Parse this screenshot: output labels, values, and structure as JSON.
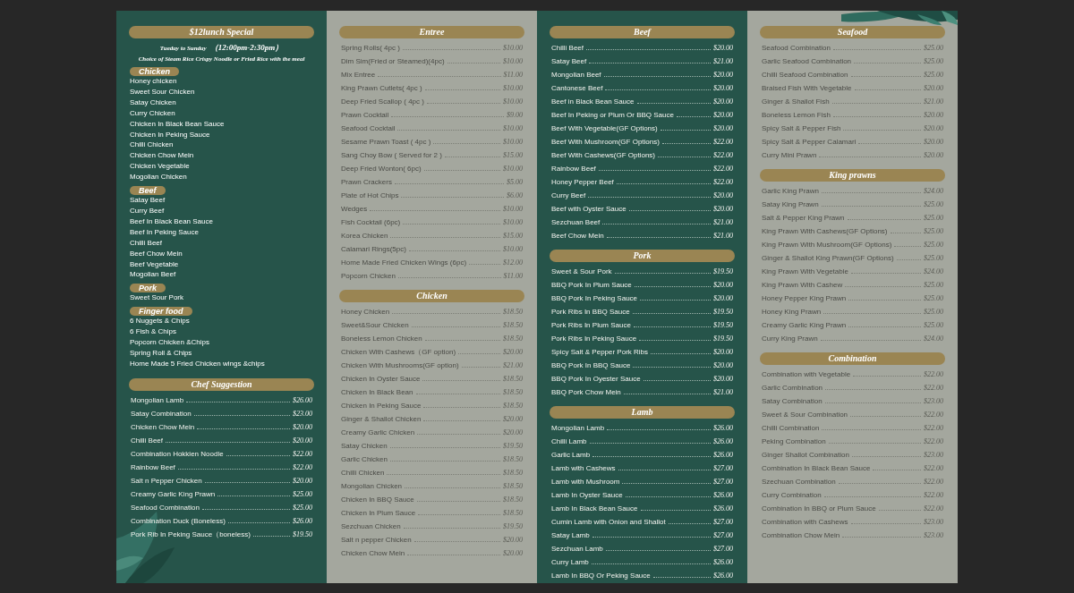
{
  "columns": [
    {
      "kind": "green",
      "sections": [
        {
          "kind": "lunch",
          "title": "$12lunch Special",
          "days": "Tueday to Sunday",
          "hours": "（12:00pm-2:30pm）",
          "note": "Choice of Steam Rice Crispy Noodle or Fried Rice with the meal",
          "groups": [
            {
              "title": "Chicken",
              "items": [
                "Honey chicken",
                "Sweet Sour Chicken",
                "Satay Chicken",
                "Curry Chicken",
                "Chicken In Black Bean Sauce",
                "Chicken In Peking Sauce",
                "Chilli Chicken",
                "Chicken Chow Mein",
                "Chicken Vegetable",
                "Mogolian Chicken"
              ]
            },
            {
              "title": "Beef",
              "items": [
                "Satay Beef",
                "Curry Beef",
                "Beef In Black Bean Sauce",
                "Beef In Peking Sauce",
                "Chilli Beef",
                "Beef Chow Mein",
                "Beef Vegetable",
                "Mogolian Beef"
              ]
            },
            {
              "title": "Pork",
              "items": [
                "Sweet Sour Pork"
              ]
            },
            {
              "title": "Finger food",
              "items": [
                "6 Nuggets & Chips",
                "6 Fish & Chips",
                "Popcorn Chicken &Chips",
                "Spring Roll & Chips",
                "Home Made 5 Fried Chicken wings &chips"
              ]
            }
          ]
        },
        {
          "kind": "priced",
          "title": "Chef Suggestion",
          "items": [
            {
              "name": "Mongolian Lamb",
              "price": "$26.00"
            },
            {
              "name": "Satay Combination",
              "price": "$23.00"
            },
            {
              "name": "Chicken Chow Mein",
              "price": "$20.00"
            },
            {
              "name": "Chilli Beef",
              "price": "$20.00"
            },
            {
              "name": "Combination Hokkien Noodle",
              "price": "$22.00"
            },
            {
              "name": "Rainbow Beef",
              "price": "$22.00"
            },
            {
              "name": "Salt n Pepper Chicken",
              "price": "$20.00"
            },
            {
              "name": "Creamy Garlic King Prawn",
              "price": "$25.00"
            },
            {
              "name": "Seafood Combination",
              "price": "$25.00"
            },
            {
              "name": "Combination Duck (Boneless)",
              "price": "$26.00"
            },
            {
              "name": "Pork Rib In Peking Sauce（boneless)",
              "price": "$19.50"
            }
          ]
        }
      ]
    },
    {
      "kind": "grey",
      "sections": [
        {
          "kind": "priced",
          "title": "Entree",
          "items": [
            {
              "name": "Spring Rolls( 4pc )",
              "price": "$10.00"
            },
            {
              "name": "Dim Sim(Fried or Steamed)(4pc)",
              "price": "$10.00"
            },
            {
              "name": "Mix Entree",
              "price": "$11.00"
            },
            {
              "name": "King Prawn Cutlets( 4pc )",
              "price": "$10.00"
            },
            {
              "name": "Deep Fried Scallop ( 4pc )",
              "price": "$10.00"
            },
            {
              "name": "Prawn Cocktail",
              "price": "$9.00"
            },
            {
              "name": "Seafood Cocktail",
              "price": "$10.00"
            },
            {
              "name": "Sesame Prawn Toast ( 4pc )",
              "price": "$10.00"
            },
            {
              "name": "Sang Choy Bow ( Served for 2 )",
              "price": "$15.00"
            },
            {
              "name": "Deep Fried Wonton( 6pc)",
              "price": "$10.00"
            },
            {
              "name": "Prawn Crackers",
              "price": "$5.00"
            },
            {
              "name": "Plate of Hot Chips",
              "price": "$6.00"
            },
            {
              "name": "Wedges",
              "price": "$10.00"
            },
            {
              "name": "Fish Cocktail (6pc)",
              "price": "$10.00"
            },
            {
              "name": "Korea Chicken",
              "price": "$15.00"
            },
            {
              "name": "Calamari Rings(5pc)",
              "price": "$10.00"
            },
            {
              "name": "Home Made Fried Chicken Wings (6pc)",
              "price": "$12.00"
            },
            {
              "name": "Popcorn Chicken",
              "price": "$11.00"
            }
          ]
        },
        {
          "kind": "priced",
          "title": "Chicken",
          "items": [
            {
              "name": "Honey Chicken",
              "price": "$18.50"
            },
            {
              "name": "Sweet&Sour Chicken",
              "price": "$18.50"
            },
            {
              "name": "Boneless Lemon Chicken",
              "price": "$18.50"
            },
            {
              "name": "Chicken With Cashews（GF option)",
              "price": "$20.00"
            },
            {
              "name": "Chicken With Mushrooms(GF option)",
              "price": "$21.00"
            },
            {
              "name": "Chicken In Oyster Sauce",
              "price": "$18.50"
            },
            {
              "name": "Chicken In Black Bean",
              "price": "$18.50"
            },
            {
              "name": "Chicken In Peking Sauce",
              "price": "$18.50"
            },
            {
              "name": "Ginger & Shallot Chicken",
              "price": "$20.00"
            },
            {
              "name": "Creamy Garlic Chicken",
              "price": "$20.00"
            },
            {
              "name": "Satay Chicken",
              "price": "$19.50"
            },
            {
              "name": "Garlic Chicken",
              "price": "$18.50"
            },
            {
              "name": "Chilli Chicken",
              "price": "$18.50"
            },
            {
              "name": "Mongolian Chicken",
              "price": "$18.50"
            },
            {
              "name": "Chicken In BBQ Sauce",
              "price": "$18.50"
            },
            {
              "name": "Chicken In Plum Sauce",
              "price": "$18.50"
            },
            {
              "name": "Sezchuan Chicken",
              "price": "$19.50"
            },
            {
              "name": "Salt n pepper Chicken",
              "price": "$20.00"
            },
            {
              "name": "Chicken Chow Mein",
              "price": "$20.00"
            }
          ]
        }
      ]
    },
    {
      "kind": "green",
      "sections": [
        {
          "kind": "priced",
          "title": "Beef",
          "items": [
            {
              "name": "Chilli Beef",
              "price": "$20.00"
            },
            {
              "name": "Satay Beef",
              "price": "$21.00"
            },
            {
              "name": "Mongolian Beef",
              "price": "$20.00"
            },
            {
              "name": "Cantonese Beef",
              "price": "$20.00"
            },
            {
              "name": "Beef in Black Bean Sauce",
              "price": "$20.00"
            },
            {
              "name": "Beef In Peking or Plum Or BBQ Sauce",
              "price": "$20.00"
            },
            {
              "name": "Beef With Vegetable(GF Options)",
              "price": "$20.00"
            },
            {
              "name": "Beef With Mushroom(GF Options)",
              "price": "$22.00"
            },
            {
              "name": "Beef With Cashews(GF Options)",
              "price": "$22.00"
            },
            {
              "name": "Rainbow Beef",
              "price": "$22.00"
            },
            {
              "name": "Honey Pepper Beef",
              "price": "$22.00"
            },
            {
              "name": "Curry Beef",
              "price": "$20.00"
            },
            {
              "name": "Beef with Oyster Sauce",
              "price": "$20.00"
            },
            {
              "name": "Sezchuan Beef",
              "price": "$21.00"
            },
            {
              "name": "Beef Chow Mein",
              "price": "$21.00"
            }
          ]
        },
        {
          "kind": "priced",
          "title": "Pork",
          "items": [
            {
              "name": "Sweet & Sour Pork",
              "price": "$19.50"
            },
            {
              "name": "BBQ Pork In Plum Sauce",
              "price": "$20.00"
            },
            {
              "name": "BBQ Pork In Peking Sauce",
              "price": "$20.00"
            },
            {
              "name": "Pork Ribs In BBQ Sauce",
              "price": "$19.50"
            },
            {
              "name": "Pork Ribs In Plum Sauce",
              "price": "$19.50"
            },
            {
              "name": "Pork Ribs In Peking Sauce",
              "price": "$19.50"
            },
            {
              "name": "Spicy Salt & Pepper Pork Ribs",
              "price": "$20.00"
            },
            {
              "name": "BBQ Pork In BBQ Sauce",
              "price": "$20.00"
            },
            {
              "name": "BBQ Pork In Oyester Sauce",
              "price": "$20.00"
            },
            {
              "name": "BBQ Pork Chow Mein",
              "price": "$21.00"
            }
          ]
        },
        {
          "kind": "priced",
          "title": "Lamb",
          "items": [
            {
              "name": "Mongolian Lamb",
              "price": "$26.00"
            },
            {
              "name": "Chilli Lamb",
              "price": "$26.00"
            },
            {
              "name": "Garlic Lamb",
              "price": "$26.00"
            },
            {
              "name": "Lamb with Cashews",
              "price": "$27.00"
            },
            {
              "name": "Lamb with Mushroom",
              "price": "$27.00"
            },
            {
              "name": "Lamb In Oyster Sauce",
              "price": "$26.00"
            },
            {
              "name": "Lamb In Black Bean Sauce",
              "price": "$26.00"
            },
            {
              "name": "Cumin Lamb with Onion and Shallot",
              "price": "$27.00"
            },
            {
              "name": "Satay Lamb",
              "price": "$27.00"
            },
            {
              "name": "Sezchuan Lamb",
              "price": "$27.00"
            },
            {
              "name": "Curry Lamb",
              "price": "$26.00"
            },
            {
              "name": "Lamb In BBQ Or Peking Sauce",
              "price": "$26.00"
            }
          ]
        }
      ]
    },
    {
      "kind": "grey",
      "sections": [
        {
          "kind": "priced",
          "title": "Seafood",
          "items": [
            {
              "name": "Seafood Combination",
              "price": "$25.00"
            },
            {
              "name": "Garlic Seafood Combination",
              "price": "$25.00"
            },
            {
              "name": "Chilli Seafood Combination",
              "price": "$25.00"
            },
            {
              "name": "Braised Fish With Vegetable",
              "price": "$20.00"
            },
            {
              "name": "Ginger & Shallot Fish",
              "price": "$21.00"
            },
            {
              "name": "Boneless Lemon Fish",
              "price": "$20.00"
            },
            {
              "name": "Spicy Salt & Pepper Fish",
              "price": "$20.00"
            },
            {
              "name": "Spicy Salt & Pepper Calamari",
              "price": "$20.00"
            },
            {
              "name": "Curry Mini Prawn",
              "price": "$20.00"
            }
          ]
        },
        {
          "kind": "priced",
          "title": "King prawns",
          "items": [
            {
              "name": "Garlic King Prawn",
              "price": "$24.00"
            },
            {
              "name": "Satay King Prawn",
              "price": "$25.00"
            },
            {
              "name": "Salt & Pepper King Prawn",
              "price": "$25.00"
            },
            {
              "name": "King Prawn With Cashews(GF Options)",
              "price": "$25.00"
            },
            {
              "name": "King Prawn With Mushroom(GF Options)",
              "price": "$25.00"
            },
            {
              "name": "Ginger & Shallot King Prawn(GF Options)",
              "price": "$25.00"
            },
            {
              "name": "King Prawn With Vegetable",
              "price": "$24.00"
            },
            {
              "name": "King Prawn With Cashew",
              "price": "$25.00"
            },
            {
              "name": "Honey Pepper King Prawn",
              "price": "$25.00"
            },
            {
              "name": "Honey King Prawn",
              "price": "$25.00"
            },
            {
              "name": "Creamy Garlic King Prawn",
              "price": "$25.00"
            },
            {
              "name": "Curry King Prawn",
              "price": "$24.00"
            }
          ]
        },
        {
          "kind": "priced",
          "title": "Combination",
          "items": [
            {
              "name": "Combination with Vegetable",
              "price": "$22.00"
            },
            {
              "name": "Garlic Combination",
              "price": "$22.00"
            },
            {
              "name": "Satay Combination",
              "price": "$23.00"
            },
            {
              "name": "Sweet & Sour Combination",
              "price": "$22.00"
            },
            {
              "name": "Chilli Combination",
              "price": "$22.00"
            },
            {
              "name": "Peking Combination",
              "price": "$22.00"
            },
            {
              "name": "Ginger Shallot Combination",
              "price": "$23.00"
            },
            {
              "name": "Combination In Black Bean Sauce",
              "price": "$22.00"
            },
            {
              "name": "Szechuan Combination",
              "price": "$22.00"
            },
            {
              "name": "Curry Combination",
              "price": "$22.00"
            },
            {
              "name": "Combination In BBQ or Plum Sauce",
              "price": "$22.00"
            },
            {
              "name": "Combination with Cashews",
              "price": "$23.00"
            },
            {
              "name": "Combination Chow Mein",
              "price": "$23.00"
            }
          ]
        }
      ]
    }
  ]
}
